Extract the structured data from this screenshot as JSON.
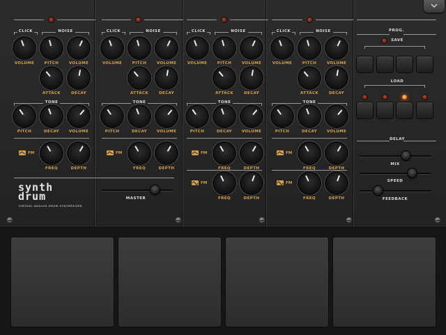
{
  "sections": {
    "click": "CLICK",
    "noise": "NOISE",
    "tone": "TONE",
    "prog": "PROG.",
    "save": "SAVE",
    "load": "LOAD",
    "delay": "DELAY"
  },
  "knob_labels": {
    "volume": "VOLUME",
    "pitch": "PITCH",
    "attack": "ATTACK",
    "decay": "DECAY",
    "freq": "FREQ",
    "depth": "DEPTH"
  },
  "fm_label": "FM",
  "slider_labels": {
    "master": "MASTER",
    "mix": "MIX",
    "speed": "SPEED",
    "feedback": "FEEDBACK"
  },
  "logo": {
    "line1": "synth",
    "line2": "drum",
    "tagline": "VIRTUAL ANALOG DRUM SYNTHESIZER"
  },
  "icons": {
    "menu": "chevron-down-icon",
    "fm": "waveform-icon"
  },
  "colors": {
    "label_accent": "#d9a24a",
    "led_on": "#ff7a20"
  }
}
